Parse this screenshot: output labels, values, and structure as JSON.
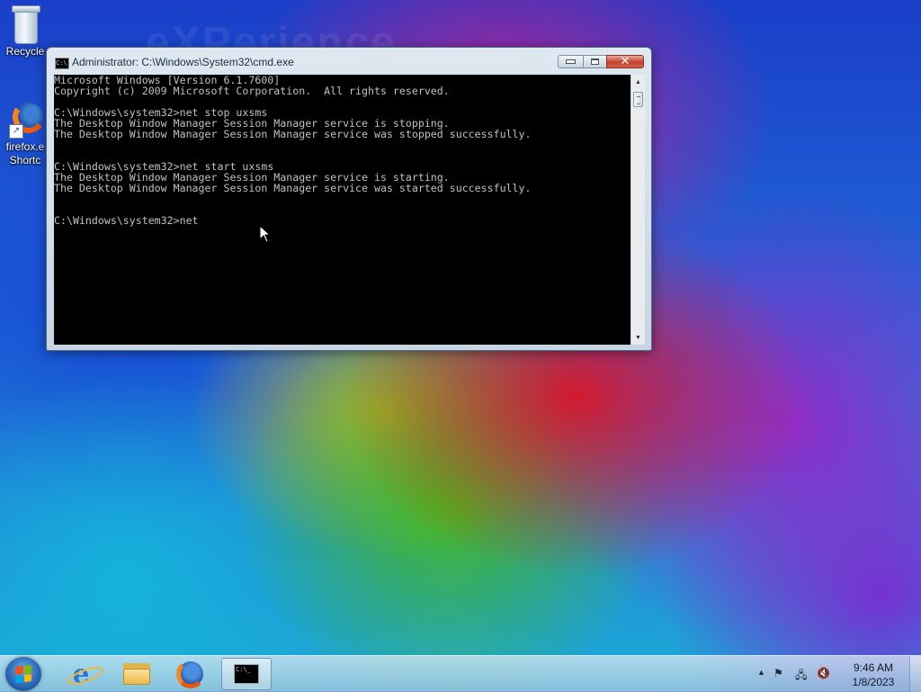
{
  "desktop": {
    "watermark": "eXPerience",
    "icons": [
      {
        "label": "Recycle",
        "icon": "recycle-bin-icon"
      },
      {
        "label": "firefox.e",
        "label2": "Shortc",
        "icon": "firefox-shortcut-icon"
      }
    ]
  },
  "window": {
    "title": "Administrator: C:\\Windows\\System32\\cmd.exe",
    "icon_text": "C:\\",
    "close_symbol": "✕",
    "console_lines": [
      "Microsoft Windows [Version 6.1.7600]",
      "Copyright (c) 2009 Microsoft Corporation.  All rights reserved.",
      "",
      "C:\\Windows\\system32>net stop uxsms",
      "The Desktop Window Manager Session Manager service is stopping.",
      "The Desktop Window Manager Session Manager service was stopped successfully.",
      "",
      "",
      "C:\\Windows\\system32>net start uxsms",
      "The Desktop Window Manager Session Manager service is starting.",
      "The Desktop Window Manager Session Manager service was started successfully.",
      "",
      "",
      "C:\\Windows\\system32>net"
    ],
    "scroll_up": "▲",
    "scroll_down": "▼"
  },
  "taskbar": {
    "buttons": [
      {
        "name": "internet-explorer",
        "icon": "ie-icon",
        "glyph": "e"
      },
      {
        "name": "windows-explorer",
        "icon": "folder-icon"
      },
      {
        "name": "firefox",
        "icon": "firefox-icon"
      },
      {
        "name": "cmd",
        "icon": "cmd-icon",
        "glyph": "C:\\_"
      }
    ],
    "tray": {
      "arrow": "▲",
      "flag": "⚑",
      "network": "🖧",
      "volume": "🔇"
    },
    "clock": {
      "time": "9:46 AM",
      "date": "1/8/2023"
    }
  },
  "colors": {
    "console_bg": "#000000",
    "console_fg": "#c0c0c0",
    "close_red": "#c4432c"
  }
}
